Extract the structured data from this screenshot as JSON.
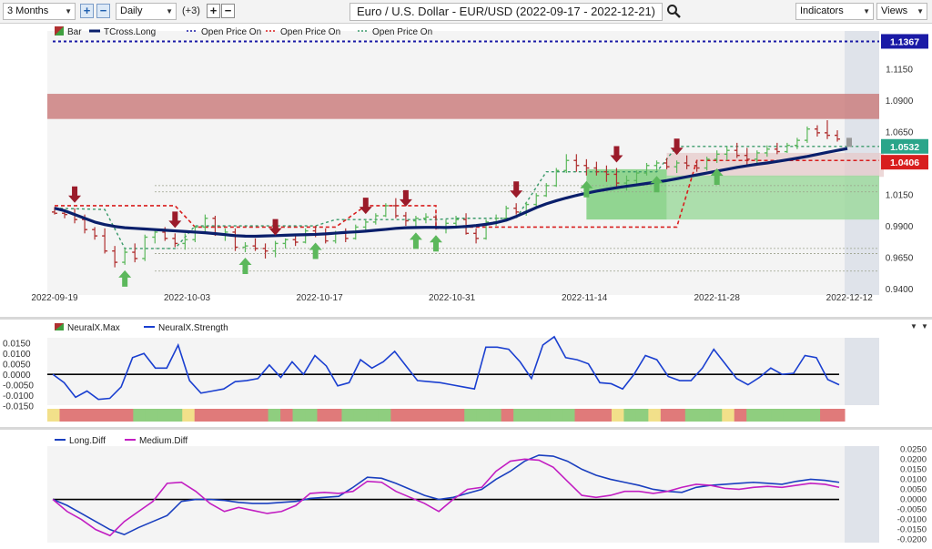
{
  "toolbar": {
    "period": "3 Months",
    "interval": "Daily",
    "extra": "(+3)",
    "symbol_title": "Euro / U.S. Dollar - EUR/USD (2022-09-17 - 2022-12-21)",
    "indicators_label": "Indicators",
    "views_label": "Views"
  },
  "colors": {
    "up": "#5cb85c",
    "down": "#b03030",
    "tcross": "#0a1f6b",
    "blue_ref": "#1a1aa6",
    "red_ref": "#d81e1e",
    "green_ref": "#3a9a6a"
  },
  "chart_data": [
    {
      "type": "line",
      "legend": [
        "Bar",
        "TCross.Long",
        "Open Price On",
        "Open Price On",
        "Open Price On"
      ],
      "x_ticks": [
        "2022-09-19",
        "2022-10-03",
        "2022-10-17",
        "2022-10-31",
        "2022-11-14",
        "2022-11-28",
        "2022-12-12"
      ],
      "y_ticks": [
        "1.1150",
        "1.0900",
        "1.0650",
        "1.0150",
        "0.9900",
        "0.9650",
        "0.9400"
      ],
      "ylim": [
        0.935,
        1.145
      ],
      "price_tags": [
        {
          "value": "1.1367",
          "color": "#1a1aa6"
        },
        {
          "value": "1.0532",
          "color": "#2aa58a"
        },
        {
          "value": "1.0406",
          "color": "#d81e1e"
        }
      ],
      "candles": [
        [
          1.001,
          1.005,
          0.999,
          1.0
        ],
        [
          1.0,
          1.003,
          0.996,
          0.999
        ],
        [
          0.999,
          1.004,
          0.992,
          0.995
        ],
        [
          0.995,
          0.999,
          0.984,
          0.987
        ],
        [
          0.987,
          0.989,
          0.979,
          0.982
        ],
        [
          0.982,
          0.988,
          0.968,
          0.97
        ],
        [
          0.97,
          0.974,
          0.957,
          0.961
        ],
        [
          0.961,
          0.972,
          0.959,
          0.969
        ],
        [
          0.969,
          0.976,
          0.961,
          0.964
        ],
        [
          0.964,
          0.983,
          0.962,
          0.981
        ],
        [
          0.981,
          0.988,
          0.976,
          0.985
        ],
        [
          0.985,
          0.989,
          0.978,
          0.98
        ],
        [
          0.98,
          0.984,
          0.973,
          0.976
        ],
        [
          0.976,
          0.984,
          0.971,
          0.979
        ],
        [
          0.979,
          0.99,
          0.977,
          0.989
        ],
        [
          0.989,
          0.999,
          0.985,
          0.996
        ],
        [
          0.996,
          0.998,
          0.982,
          0.983
        ],
        [
          0.983,
          0.988,
          0.978,
          0.985
        ],
        [
          0.985,
          0.988,
          0.97,
          0.973
        ],
        [
          0.973,
          0.977,
          0.969,
          0.974
        ],
        [
          0.974,
          0.98,
          0.97,
          0.972
        ],
        [
          0.972,
          0.976,
          0.964,
          0.97
        ],
        [
          0.97,
          0.978,
          0.965,
          0.976
        ],
        [
          0.976,
          0.98,
          0.972,
          0.979
        ],
        [
          0.979,
          0.983,
          0.974,
          0.977
        ],
        [
          0.977,
          0.988,
          0.976,
          0.986
        ],
        [
          0.986,
          0.99,
          0.981,
          0.983
        ],
        [
          0.983,
          0.988,
          0.976,
          0.978
        ],
        [
          0.978,
          0.986,
          0.976,
          0.984
        ],
        [
          0.984,
          0.988,
          0.977,
          0.98
        ],
        [
          0.98,
          0.991,
          0.979,
          0.989
        ],
        [
          0.989,
          0.995,
          0.986,
          0.993
        ],
        [
          0.993,
          1.0,
          0.991,
          0.998
        ],
        [
          0.998,
          1.008,
          0.997,
          1.006
        ],
        [
          1.006,
          1.012,
          0.996,
          0.998
        ],
        [
          0.998,
          1.001,
          0.99,
          0.994
        ],
        [
          0.994,
          0.998,
          0.989,
          0.996
        ],
        [
          0.996,
          1.0,
          0.992,
          0.997
        ],
        [
          0.997,
          0.999,
          0.987,
          0.988
        ],
        [
          0.988,
          0.995,
          0.984,
          0.992
        ],
        [
          0.992,
          0.998,
          0.988,
          0.995
        ],
        [
          0.995,
          1.0,
          0.983,
          0.984
        ],
        [
          0.984,
          0.988,
          0.976,
          0.98
        ],
        [
          0.98,
          0.995,
          0.979,
          0.993
        ],
        [
          0.993,
          0.999,
          0.99,
          0.996
        ],
        [
          0.996,
          1.006,
          0.995,
          1.004
        ],
        [
          1.004,
          1.008,
          0.999,
          1.001
        ],
        [
          1.001,
          1.009,
          0.998,
          1.007
        ],
        [
          1.007,
          1.016,
          1.005,
          1.014
        ],
        [
          1.014,
          1.024,
          1.013,
          1.022
        ],
        [
          1.022,
          1.036,
          1.021,
          1.034
        ],
        [
          1.034,
          1.047,
          1.032,
          1.042
        ],
        [
          1.042,
          1.047,
          1.033,
          1.038
        ],
        [
          1.038,
          1.043,
          1.03,
          1.036
        ],
        [
          1.036,
          1.041,
          1.03,
          1.033
        ],
        [
          1.033,
          1.038,
          1.025,
          1.031
        ],
        [
          1.031,
          1.036,
          1.02,
          1.024
        ],
        [
          1.024,
          1.03,
          1.018,
          1.026
        ],
        [
          1.026,
          1.034,
          1.023,
          1.032
        ],
        [
          1.032,
          1.04,
          1.03,
          1.038
        ],
        [
          1.038,
          1.042,
          1.034,
          1.04
        ],
        [
          1.04,
          1.044,
          1.035,
          1.037
        ],
        [
          1.037,
          1.042,
          1.032,
          1.04
        ],
        [
          1.04,
          1.046,
          1.035,
          1.038
        ],
        [
          1.038,
          1.042,
          1.033,
          1.036
        ],
        [
          1.036,
          1.045,
          1.034,
          1.043
        ],
        [
          1.043,
          1.05,
          1.04,
          1.047
        ],
        [
          1.047,
          1.053,
          1.042,
          1.05
        ],
        [
          1.05,
          1.056,
          1.044,
          1.046
        ],
        [
          1.046,
          1.052,
          1.038,
          1.043
        ],
        [
          1.043,
          1.05,
          1.039,
          1.048
        ],
        [
          1.048,
          1.054,
          1.045,
          1.051
        ],
        [
          1.051,
          1.056,
          1.047,
          1.049
        ],
        [
          1.049,
          1.056,
          1.048,
          1.054
        ],
        [
          1.054,
          1.06,
          1.051,
          1.058
        ],
        [
          1.058,
          1.069,
          1.056,
          1.067
        ],
        [
          1.067,
          1.07,
          1.061,
          1.064
        ],
        [
          1.064,
          1.074,
          1.059,
          1.062
        ],
        [
          1.062,
          1.066,
          1.057,
          1.059
        ]
      ],
      "tcross_long": [
        1.004,
        1.002,
        0.999,
        0.996,
        0.993,
        0.991,
        0.9895,
        0.9885,
        0.988,
        0.9875,
        0.987,
        0.9865,
        0.986,
        0.9855,
        0.985,
        0.9845,
        0.9838,
        0.983,
        0.9822,
        0.9818,
        0.9817,
        0.982,
        0.9822,
        0.9825,
        0.9828,
        0.983,
        0.9832,
        0.9836,
        0.9842,
        0.9848,
        0.9852,
        0.9858,
        0.9865,
        0.9872,
        0.988,
        0.9885,
        0.9887,
        0.9888,
        0.9888,
        0.9887,
        0.989,
        0.9895,
        0.9902,
        0.9912,
        0.9925,
        0.9945,
        0.9975,
        1.001,
        1.0045,
        1.0075,
        1.01,
        1.0122,
        1.0142,
        1.016,
        1.0176,
        1.019,
        1.0203,
        1.0215,
        1.0226,
        1.0237,
        1.0248,
        1.026,
        1.0275,
        1.029,
        1.0305,
        1.032,
        1.0335,
        1.035,
        1.0365,
        1.0378,
        1.039,
        1.04,
        1.0412,
        1.0425,
        1.0438,
        1.0452,
        1.0468,
        1.0485,
        1.05,
        1.0515
      ],
      "down_arrows": [
        2,
        12,
        22,
        31,
        35,
        46,
        56,
        62
      ],
      "up_arrows": [
        7,
        19,
        26,
        36,
        38,
        53,
        60,
        66
      ],
      "ref_lines": [
        {
          "label": "Open Price On",
          "value": 1.1367,
          "color": "#1a1aa6"
        },
        {
          "label": "Open Price On",
          "value": 1.0406,
          "color": "#d81e1e"
        },
        {
          "label": "Open Price On",
          "value": 1.0532,
          "color": "#3a9a6a"
        }
      ],
      "resistance_zone": [
        1.075,
        1.095
      ]
    },
    {
      "type": "line",
      "legend": [
        "NeuralX.Max",
        "NeuralX.Strength"
      ],
      "y_ticks": [
        "0.0150",
        "0.0100",
        "0.0050",
        "0.0000",
        "-0.0050",
        "-0.0100",
        "-0.0150"
      ],
      "ylim": [
        -0.0165,
        0.0175
      ],
      "values": [
        0.0,
        -0.004,
        -0.011,
        -0.008,
        -0.012,
        -0.0115,
        -0.006,
        0.008,
        0.01,
        0.003,
        0.003,
        0.014,
        -0.003,
        -0.009,
        -0.008,
        -0.007,
        -0.0035,
        -0.003,
        -0.002,
        0.0045,
        -0.0015,
        0.006,
        0.0,
        0.009,
        0.004,
        -0.0055,
        -0.004,
        0.007,
        0.003,
        0.006,
        0.011,
        0.004,
        -0.003,
        -0.0035,
        -0.004,
        -0.005,
        -0.006,
        -0.007,
        0.013,
        0.013,
        0.012,
        0.006,
        -0.002,
        0.014,
        0.018,
        0.008,
        0.007,
        0.005,
        -0.004,
        -0.0045,
        -0.007,
        0.0,
        0.009,
        0.007,
        -0.001,
        -0.003,
        -0.003,
        0.003,
        0.012,
        0.005,
        -0.002,
        -0.005,
        -0.0015,
        0.003,
        0.0,
        0.0005,
        0.009,
        0.008,
        -0.0025,
        -0.005
      ],
      "strip": [
        "y",
        "r",
        "r",
        "r",
        "r",
        "r",
        "r",
        "g",
        "g",
        "g",
        "g",
        "y",
        "r",
        "r",
        "r",
        "r",
        "r",
        "r",
        "g",
        "r",
        "g",
        "g",
        "r",
        "r",
        "g",
        "g",
        "g",
        "g",
        "r",
        "r",
        "r",
        "r",
        "r",
        "r",
        "g",
        "g",
        "g",
        "r",
        "g",
        "g",
        "g",
        "g",
        "g",
        "r",
        "r",
        "r",
        "y",
        "g",
        "g",
        "y",
        "r",
        "r",
        "g",
        "g",
        "g",
        "y",
        "r",
        "g",
        "g",
        "g",
        "g",
        "g",
        "g",
        "r",
        "r"
      ]
    },
    {
      "type": "line",
      "legend": [
        "Long.Diff",
        "Medium.Diff"
      ],
      "y_ticks": [
        "0.0250",
        "0.0200",
        "0.0150",
        "0.0100",
        "0.0050",
        "0.0000",
        "-0.0050",
        "-0.0100",
        "-0.0150",
        "-0.0200"
      ],
      "ylim": [
        -0.0215,
        0.0265
      ],
      "series": [
        {
          "name": "Long.Diff",
          "color": "#1a3fbf",
          "values": [
            0.0,
            -0.003,
            -0.007,
            -0.011,
            -0.015,
            -0.0175,
            -0.014,
            -0.011,
            -0.008,
            -0.001,
            0.0,
            0.0,
            -0.0005,
            -0.0015,
            -0.002,
            -0.002,
            -0.0015,
            -0.001,
            0.0005,
            0.001,
            0.0015,
            0.006,
            0.011,
            0.0105,
            0.008,
            0.005,
            0.002,
            0.0,
            0.001,
            0.003,
            0.005,
            0.01,
            0.014,
            0.019,
            0.022,
            0.0215,
            0.019,
            0.015,
            0.012,
            0.01,
            0.0085,
            0.007,
            0.005,
            0.004,
            0.0035,
            0.006,
            0.007,
            0.0075,
            0.008,
            0.0085,
            0.008,
            0.0075,
            0.009,
            0.01,
            0.0095,
            0.0085
          ]
        },
        {
          "name": "Medium.Diff",
          "color": "#c21ec2",
          "values": [
            0.0,
            -0.006,
            -0.01,
            -0.015,
            -0.018,
            -0.011,
            -0.006,
            -0.001,
            0.008,
            0.0085,
            0.004,
            -0.002,
            -0.006,
            -0.004,
            -0.0055,
            -0.007,
            -0.006,
            -0.003,
            0.003,
            0.0035,
            0.003,
            0.004,
            0.009,
            0.0085,
            0.004,
            0.001,
            -0.002,
            -0.006,
            0.0,
            0.005,
            0.006,
            0.014,
            0.019,
            0.02,
            0.0195,
            0.016,
            0.009,
            0.002,
            0.001,
            0.002,
            0.004,
            0.004,
            0.003,
            0.004,
            0.006,
            0.0075,
            0.007,
            0.0055,
            0.005,
            0.006,
            0.0065,
            0.006,
            0.007,
            0.008,
            0.0075,
            0.006
          ]
        }
      ]
    }
  ]
}
